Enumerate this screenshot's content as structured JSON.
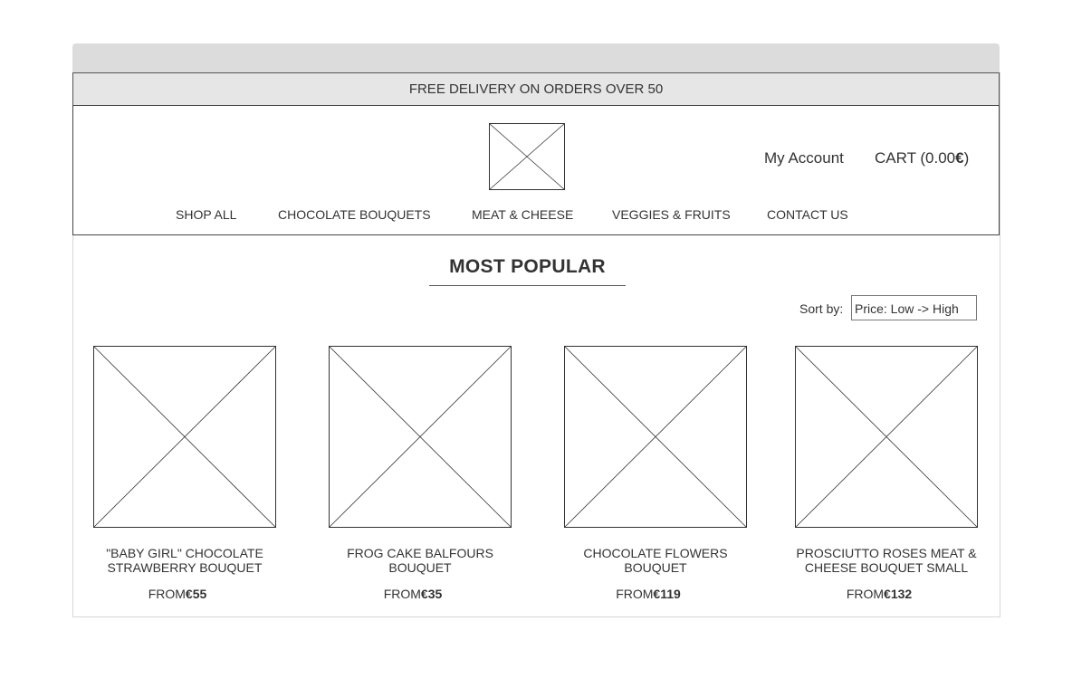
{
  "promo": {
    "text": "FREE DELIVERY ON ORDERS OVER 50"
  },
  "header": {
    "logo_icon": "image-placeholder-icon",
    "account_label": "My Account",
    "cart": {
      "label": "CART (0.00",
      "currency": "€",
      "close": ")"
    }
  },
  "nav": {
    "items": [
      {
        "label": "SHOP ALL"
      },
      {
        "label": "CHOCOLATE BOUQUETS"
      },
      {
        "label": "MEAT & CHEESE"
      },
      {
        "label": "VEGGIES & FRUITS"
      },
      {
        "label": "CONTACT US"
      }
    ]
  },
  "section": {
    "title": "MOST POPULAR"
  },
  "sort": {
    "label": "Sort by:",
    "selected": "Price: Low -> High"
  },
  "products": [
    {
      "name": "\"BABY GIRL\" CHOCOLATE STRAWBERRY BOUQUET",
      "price_prefix": "FROM",
      "price": "€55",
      "image_icon": "image-placeholder-icon"
    },
    {
      "name": "FROG CAKE BALFOURS BOUQUET",
      "price_prefix": "FROM",
      "price": "€35",
      "image_icon": "image-placeholder-icon"
    },
    {
      "name": "CHOCOLATE FLOWERS BOUQUET",
      "price_prefix": "FROM",
      "price": "€119",
      "image_icon": "image-placeholder-icon"
    },
    {
      "name": "PROSCIUTTO ROSES MEAT & CHEESE BOUQUET SMALL",
      "price_prefix": "FROM",
      "price": "€132",
      "image_icon": "image-placeholder-icon"
    }
  ],
  "colors": {
    "promo_bg": "#e6e6e6",
    "browser_bar": "#dcdcdc",
    "border": "#444444",
    "text": "#333333"
  }
}
